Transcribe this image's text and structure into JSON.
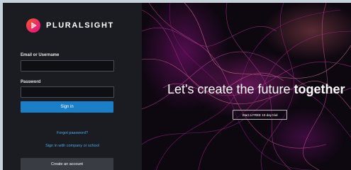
{
  "brand": {
    "name": "PLURALSIGHT"
  },
  "login": {
    "email_label": "Email or Username",
    "email_value": "",
    "password_label": "Password",
    "password_value": "",
    "sign_in_label": "Sign in",
    "forgot_password": "Forgot password?",
    "company_sign_in": "Sign in with company or school",
    "create_account": "Create an account"
  },
  "hero": {
    "headline_regular": "Let's create the future ",
    "headline_bold": "together",
    "trial_button": "Start a FREE 10-day trial"
  },
  "colors": {
    "brand_orange": "#f15b2a",
    "brand_pink": "#e80a89",
    "primary_button": "#1b7fc7",
    "link": "#4aa9e8"
  }
}
